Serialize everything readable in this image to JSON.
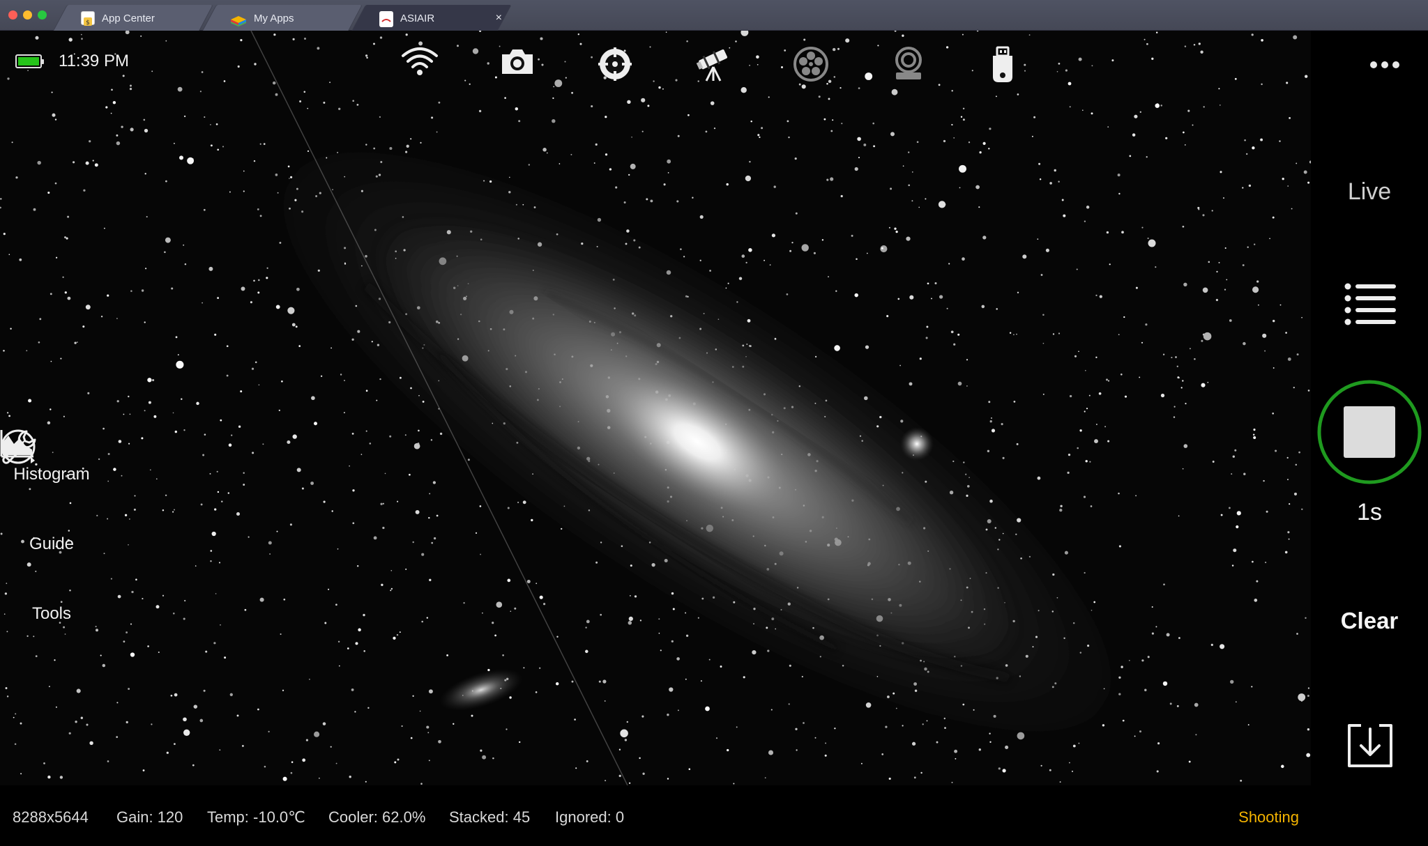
{
  "window": {
    "tabs": [
      {
        "label": "App Center",
        "icon": "app-center-icon",
        "active": false
      },
      {
        "label": "My Apps",
        "icon": "my-apps-icon",
        "active": false
      },
      {
        "label": "ASIAIR",
        "icon": "asiair-icon",
        "active": true
      }
    ],
    "close_glyph": "×"
  },
  "status": {
    "time": "11:39 PM",
    "battery_level": 1.0,
    "battery_color": "#26c41a"
  },
  "toolbar": {
    "icons": [
      "wifi-icon",
      "camera-icon",
      "guide-scope-icon",
      "telescope-icon",
      "filter-wheel-icon",
      "focuser-icon",
      "storage-icon"
    ]
  },
  "left_tools": {
    "histogram": "Histogram",
    "guide": "Guide",
    "tools": "Tools"
  },
  "right_panel": {
    "more": "more-options-icon",
    "live": "Live",
    "list": "list-icon",
    "exposure": "1s",
    "clear": "Clear",
    "download": "download-icon",
    "ring_color": "#1f9a1f"
  },
  "info": {
    "resolution": "8288x5644",
    "gain": "Gain: 120",
    "temp": "Temp: -10.0℃",
    "cooler": "Cooler: 62.0%",
    "stacked": "Stacked: 45",
    "ignored": "Ignored: 0",
    "state": "Shooting",
    "state_color": "#f5b400"
  }
}
